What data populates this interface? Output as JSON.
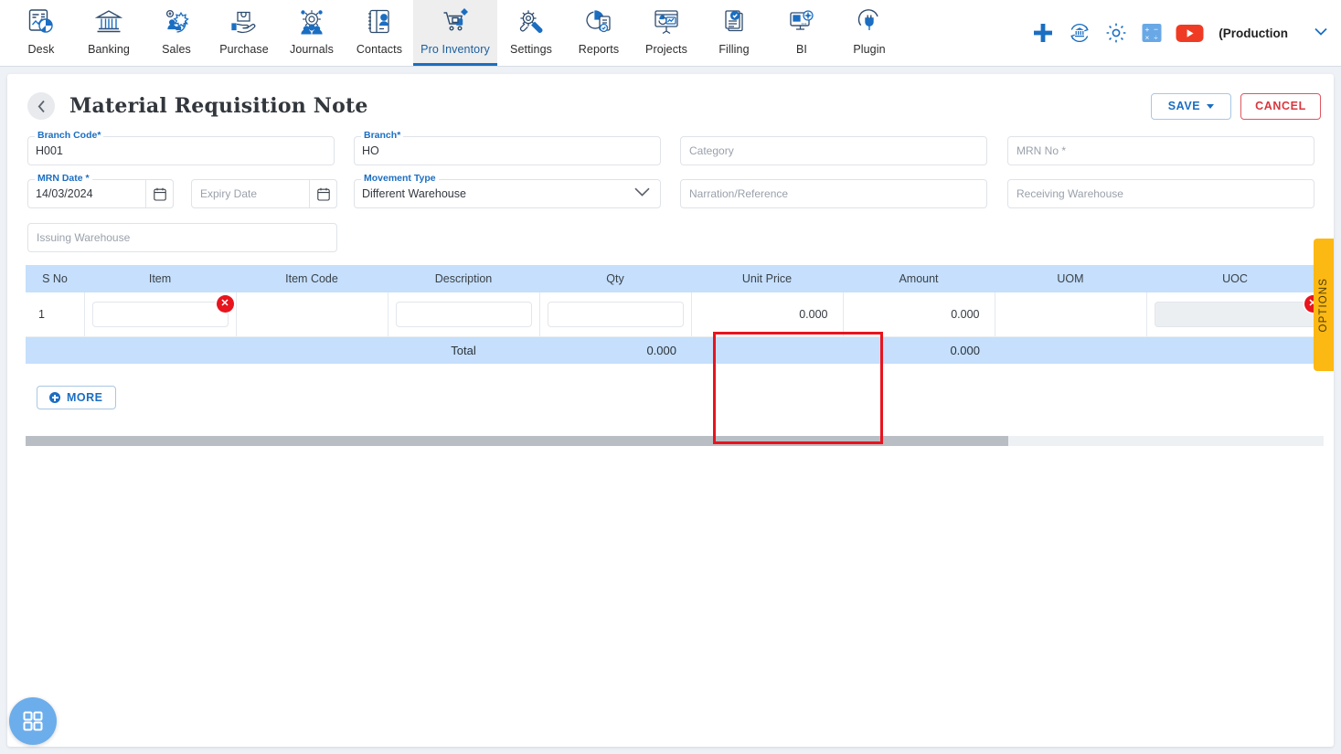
{
  "topnav": {
    "items": [
      {
        "label": "Desk",
        "icon": "dashboard-icon",
        "active": false
      },
      {
        "label": "Banking",
        "icon": "bank-icon",
        "active": false
      },
      {
        "label": "Sales",
        "icon": "sales-icon",
        "active": false
      },
      {
        "label": "Purchase",
        "icon": "purchase-icon",
        "active": false
      },
      {
        "label": "Journals",
        "icon": "journals-icon",
        "active": false
      },
      {
        "label": "Contacts",
        "icon": "contacts-icon",
        "active": false
      },
      {
        "label": "Pro Inventory",
        "icon": "inventory-cart-icon",
        "active": true
      },
      {
        "label": "Settings",
        "icon": "settings-tools-icon",
        "active": false
      },
      {
        "label": "Reports",
        "icon": "reports-piechart-icon",
        "active": false
      },
      {
        "label": "Projects",
        "icon": "projects-presentation-icon",
        "active": false
      },
      {
        "label": "Filling",
        "icon": "filling-documents-icon",
        "active": false
      },
      {
        "label": "BI",
        "icon": "bi-monitor-icon",
        "active": false
      },
      {
        "label": "Plugin",
        "icon": "plugin-plug-icon",
        "active": false
      }
    ],
    "right": {
      "add_icon": "plus-icon",
      "company_switch_icon": "bank-refresh-icon",
      "settings_icon": "gear-icon",
      "calculator_icon": "calculator-icon",
      "youtube_icon": "youtube-icon",
      "environment_label": "(Production",
      "dropdown_icon": "chevron-down-icon"
    }
  },
  "page": {
    "back_icon": "chevron-left-icon",
    "title": "Material Requisition Note",
    "save_label": "SAVE",
    "save_caret_icon": "caret-down-icon",
    "cancel_label": "CANCEL"
  },
  "form": {
    "branch_code": {
      "label": "Branch Code",
      "required": "*",
      "value": "H001"
    },
    "branch": {
      "label": "Branch",
      "required": "*",
      "value": "HO"
    },
    "category": {
      "placeholder": "Category",
      "value": ""
    },
    "mrn_no": {
      "placeholder": "MRN No",
      "required": "*",
      "value": ""
    },
    "mrn_date": {
      "label": "MRN Date",
      "required": "*",
      "value": "14/03/2024",
      "icon": "calendar-icon"
    },
    "expiry_date": {
      "placeholder": "Expiry Date",
      "value": "",
      "icon": "calendar-icon"
    },
    "movement_type": {
      "label": "Movement Type",
      "value": "Different Warehouse",
      "icon": "chevron-down-icon"
    },
    "narration": {
      "placeholder": "Narration/Reference",
      "value": ""
    },
    "receiving_warehouse": {
      "placeholder": "Receiving Warehouse",
      "value": ""
    },
    "issuing_warehouse": {
      "placeholder": "Issuing Warehouse",
      "value": ""
    }
  },
  "grid": {
    "columns": [
      "S No",
      "Item",
      "Item Code",
      "Description",
      "Qty",
      "Unit Price",
      "Amount",
      "UOM",
      "UOC"
    ],
    "rows": [
      {
        "s_no": "1",
        "item": "",
        "item_code": "",
        "description": "",
        "qty": "",
        "unit_price": "0.000",
        "amount": "0.000",
        "uom": "",
        "uoc": "",
        "delete_icon": "delete-circle-icon"
      }
    ],
    "total": {
      "label": "Total",
      "qty": "0.000",
      "amount": "0.000"
    },
    "more_label": "MORE",
    "more_icon": "plus-circle-icon"
  },
  "options_tab": {
    "label": "OPTIONS"
  },
  "fab": {
    "icon": "apps-grid-icon"
  },
  "highlight": {
    "target_column": "Unit Price",
    "color": "#e8141e"
  },
  "colors": {
    "accent": "#1b6ec2",
    "danger": "#d9363e",
    "table_header": "#c5dffc",
    "options_tab": "#fcb813",
    "fab": "#6cadec"
  }
}
